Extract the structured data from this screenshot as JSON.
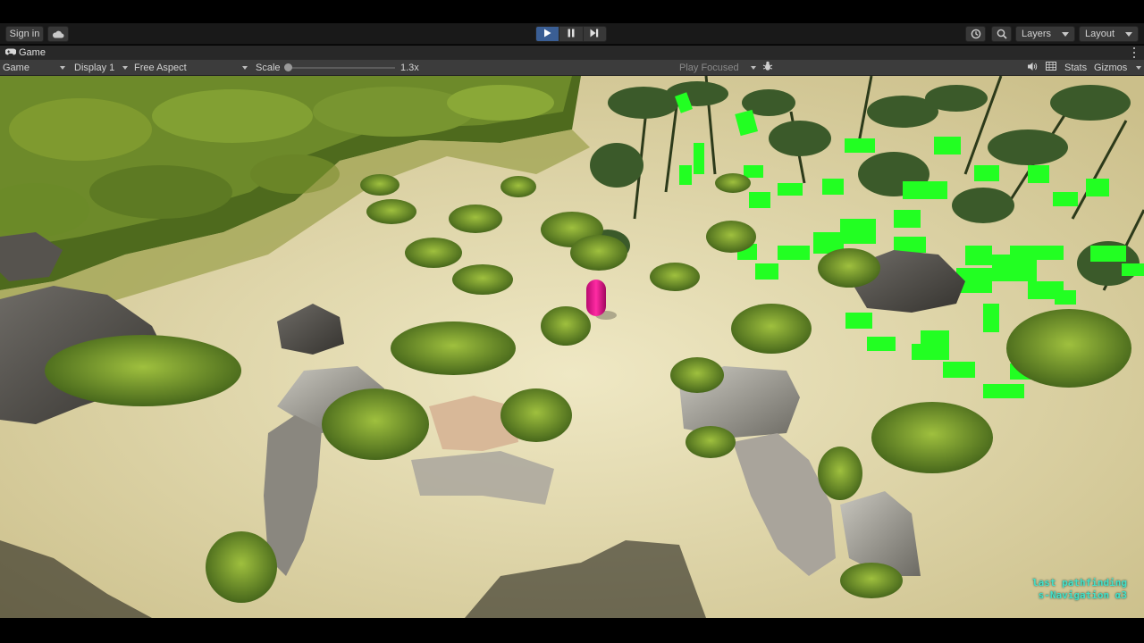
{
  "toolbar": {
    "sign_in_label": "Sign in",
    "cloud_icon": "cloud-icon",
    "play_icon": "play-icon",
    "pause_icon": "pause-icon",
    "step_icon": "step-icon",
    "history_icon": "history-icon",
    "search_icon": "search-icon",
    "layers_label": "Layers",
    "layout_label": "Layout",
    "play_active_color": "#3a5e94"
  },
  "tab": {
    "title": "Game",
    "icon": "gamepad-icon"
  },
  "game_controls": {
    "view_select": "Game",
    "display_select": "Display 1",
    "aspect_select": "Free Aspect",
    "scale_label": "Scale",
    "scale_value": "1.3x",
    "scale_slider_fraction": 0.0,
    "play_mode_select": "Play Focused",
    "stats_label": "Stats",
    "gizmos_label": "Gizmos"
  },
  "viewport": {
    "overlay_line1": "last pathfinding",
    "overlay_line2": "s-Navigation α3",
    "agent_color": "#e0118a",
    "navmesh_color": "#22ff22",
    "sand_color": "#d8cf9f",
    "forest_color": "#5d7a23"
  }
}
